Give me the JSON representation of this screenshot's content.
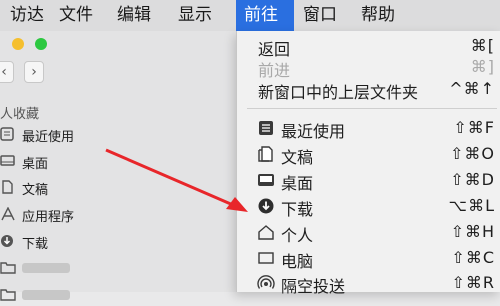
{
  "menubar": {
    "items": [
      "访达",
      "文件",
      "编辑",
      "显示",
      "前往",
      "窗口",
      "帮助"
    ],
    "active": "前往"
  },
  "finder": {
    "back_arrow": "‹",
    "forward_arrow": "›",
    "sidebar_header": "人收藏",
    "sidebar_items": [
      {
        "label": "最近使用",
        "icon": "recents-icon"
      },
      {
        "label": "桌面",
        "icon": "desktop-icon"
      },
      {
        "label": "文稿",
        "icon": "documents-icon"
      },
      {
        "label": "应用程序",
        "icon": "applications-icon"
      },
      {
        "label": "下载",
        "icon": "downloads-icon"
      },
      {
        "label": "",
        "icon": "folder-icon"
      },
      {
        "label": "",
        "icon": "folder-icon"
      }
    ]
  },
  "go_menu": {
    "top_items": [
      {
        "label": "返回",
        "shortcut": "⌘[",
        "disabled": false
      },
      {
        "label": "前进",
        "shortcut": "⌘]",
        "disabled": true
      },
      {
        "label": "新窗口中的上层文件夹",
        "shortcut": "^⌘↑",
        "disabled": false
      }
    ],
    "items": [
      {
        "label": "最近使用",
        "shortcut": "⇧⌘F",
        "icon": "recents-icon"
      },
      {
        "label": "文稿",
        "shortcut": "⇧⌘O",
        "icon": "documents-icon"
      },
      {
        "label": "桌面",
        "shortcut": "⇧⌘D",
        "icon": "desktop-icon"
      },
      {
        "label": "下载",
        "shortcut": "⌥⌘L",
        "icon": "downloads-icon"
      },
      {
        "label": "个人",
        "shortcut": "⇧⌘H",
        "icon": "home-icon"
      },
      {
        "label": "电脑",
        "shortcut": "⇧⌘C",
        "icon": "computer-icon"
      },
      {
        "label": "隔空投送",
        "shortcut": "⇧⌘R",
        "icon": "airdrop-icon"
      }
    ]
  },
  "colors": {
    "menu_highlight": "#2a6fe0",
    "annotation_arrow": "#e8262a",
    "traffic_yellow": "#f5bf2e",
    "traffic_green": "#2cc840"
  }
}
